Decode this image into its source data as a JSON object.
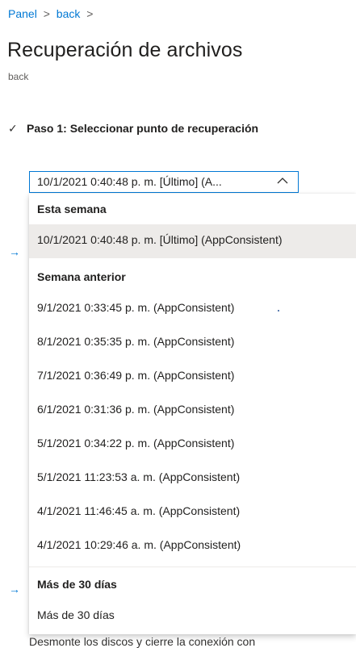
{
  "breadcrumb": {
    "items": [
      "Panel",
      "back"
    ],
    "separator": ">"
  },
  "header": {
    "title": "Recuperación de archivos",
    "subtitle": "back"
  },
  "step1": {
    "check_glyph": "✓",
    "label": "Paso 1: Seleccionar punto de recuperación"
  },
  "dropdown": {
    "selected_value": "10/1/2021 0:40:48 p. m. [Último] (A...",
    "arrow_glyph": "→",
    "groups": [
      {
        "header": "Esta semana",
        "options": [
          "10/1/2021 0:40:48 p. m. [Último] (AppConsistent)"
        ]
      },
      {
        "header": "Semana anterior",
        "options": [
          "9/1/2021 0:33:45 p. m. (AppConsistent)",
          "8/1/2021 0:35:35 p. m. (AppConsistent)",
          "7/1/2021 0:36:49 p. m. (AppConsistent)",
          "6/1/2021 0:31:36 p. m. (AppConsistent)",
          "5/1/2021 0:34:22 p. m. (AppConsistent)",
          "5/1/2021 11:23:53 a. m. (AppConsistent)",
          "4/1/2021 11:46:45 a. m. (AppConsistent)",
          "4/1/2021 10:29:46 a. m. (AppConsistent)"
        ]
      },
      {
        "header": "Más de 30 días",
        "options": [
          "Más de 30 días"
        ]
      }
    ]
  },
  "footer": {
    "text": "Desmonte los discos y cierre la conexión con"
  },
  "colors": {
    "accent": "#0078d4",
    "selected_bg": "#edebe9",
    "text": "#201f1e"
  }
}
